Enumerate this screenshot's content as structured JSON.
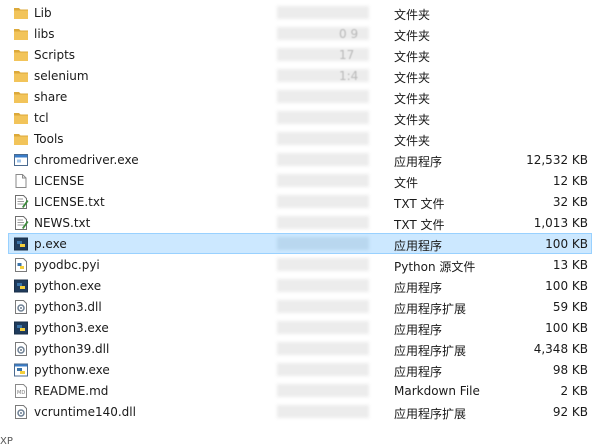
{
  "files": [
    {
      "name": "Lib",
      "type": "文件夹",
      "size": "",
      "icon": "folder-icon",
      "date_partial": ""
    },
    {
      "name": "libs",
      "type": "文件夹",
      "size": "",
      "icon": "folder-icon",
      "date_partial": "0 9"
    },
    {
      "name": "Scripts",
      "type": "文件夹",
      "size": "",
      "icon": "folder-icon",
      "date_partial": "17"
    },
    {
      "name": "selenium",
      "type": "文件夹",
      "size": "",
      "icon": "folder-icon",
      "date_partial": "1:4"
    },
    {
      "name": "share",
      "type": "文件夹",
      "size": "",
      "icon": "folder-icon",
      "date_partial": ""
    },
    {
      "name": "tcl",
      "type": "文件夹",
      "size": "",
      "icon": "folder-icon",
      "date_partial": ""
    },
    {
      "name": "Tools",
      "type": "文件夹",
      "size": "",
      "icon": "folder-icon",
      "date_partial": ""
    },
    {
      "name": "chromedriver.exe",
      "type": "应用程序",
      "size": "12,532 KB",
      "icon": "exe-window-icon",
      "date_partial": ""
    },
    {
      "name": "LICENSE",
      "type": "文件",
      "size": "12 KB",
      "icon": "blank-file-icon",
      "date_partial": ""
    },
    {
      "name": "LICENSE.txt",
      "type": "TXT 文件",
      "size": "32 KB",
      "icon": "text-file-icon",
      "date_partial": ""
    },
    {
      "name": "NEWS.txt",
      "type": "TXT 文件",
      "size": "1,013 KB",
      "icon": "text-file-icon",
      "date_partial": ""
    },
    {
      "name": "p.exe",
      "type": "应用程序",
      "size": "100 KB",
      "icon": "python-exe-icon",
      "date_partial": ""
    },
    {
      "name": "pyodbc.pyi",
      "type": "Python 源文件",
      "size": "13 KB",
      "icon": "python-source-icon",
      "date_partial": ""
    },
    {
      "name": "python.exe",
      "type": "应用程序",
      "size": "100 KB",
      "icon": "python-exe-icon",
      "date_partial": ""
    },
    {
      "name": "python3.dll",
      "type": "应用程序扩展",
      "size": "59 KB",
      "icon": "dll-file-icon",
      "date_partial": ""
    },
    {
      "name": "python3.exe",
      "type": "应用程序",
      "size": "100 KB",
      "icon": "python-exe-icon",
      "date_partial": ""
    },
    {
      "name": "python39.dll",
      "type": "应用程序扩展",
      "size": "4,348 KB",
      "icon": "dll-file-icon",
      "date_partial": ""
    },
    {
      "name": "pythonw.exe",
      "type": "应用程序",
      "size": "98 KB",
      "icon": "pythonw-exe-icon",
      "date_partial": ""
    },
    {
      "name": "README.md",
      "type": "Markdown File",
      "size": "2 KB",
      "icon": "markdown-file-icon",
      "date_partial": ""
    },
    {
      "name": "vcruntime140.dll",
      "type": "应用程序扩展",
      "size": "92 KB",
      "icon": "dll-file-icon",
      "date_partial": ""
    }
  ],
  "selected_name": "p.exe",
  "colors": {
    "folder": "#f2c45a",
    "folder_dark": "#dca93a",
    "selection_bg": "#cce8ff",
    "selection_border": "#99d1ff",
    "python_blue": "#3b73a8",
    "python_yellow": "#f4cf3c"
  },
  "status_fragment": "XP"
}
